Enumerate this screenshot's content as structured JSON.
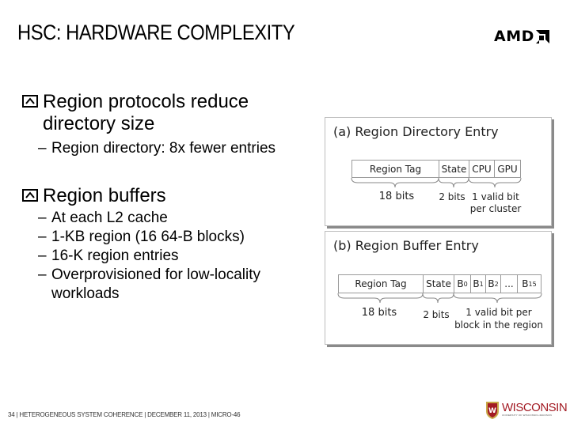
{
  "slide": {
    "title": "HSC: HARDWARE COMPLEXITY",
    "logo": "AMD"
  },
  "bullets": [
    {
      "text_lines": [
        "Region protocols reduce",
        "directory size"
      ],
      "sub": [
        "Region directory: 8x fewer entries"
      ]
    },
    {
      "text_lines": [
        "Region buffers"
      ],
      "sub": [
        "At each L2 cache",
        "1-KB region (16 64-B blocks)",
        "16-K region entries",
        "Overprovisioned for low-locality",
        "workloads"
      ]
    }
  ],
  "dash": "–",
  "figures": {
    "directory": {
      "title": "(a) Region Directory Entry",
      "cells": [
        "Region Tag",
        "State",
        "CPU",
        "GPU"
      ],
      "labels": [
        "18 bits",
        "2 bits",
        "1 valid bit",
        "per cluster"
      ]
    },
    "buffer": {
      "title": "(b) Region Buffer Entry",
      "cells": [
        "Region Tag",
        "State",
        "B",
        "B",
        "B",
        "...",
        "B"
      ],
      "subscripts": [
        "0",
        "1",
        "2",
        "",
        "15"
      ],
      "labels": [
        "18 bits",
        "2 bits",
        "1 valid bit per",
        "block in the region"
      ]
    }
  },
  "footer": {
    "text": "34  |  HETEROGENEOUS SYSTEM COHERENCE  |  DECEMBER 11, 2013  |  MICRO-46",
    "university": "WISCONSIN",
    "university_sub": "UNIVERSITY OF WISCONSIN–MADISON"
  },
  "colors": {
    "wisconsin_red": "#a31b24",
    "shadow": "#8a8a8a"
  }
}
